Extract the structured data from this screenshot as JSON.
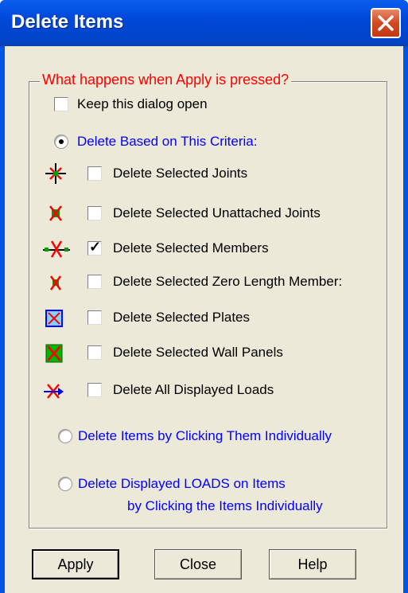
{
  "window": {
    "title": "Delete Items"
  },
  "group": {
    "legend": "What happens when Apply is pressed?"
  },
  "keep_open": {
    "label": "Keep this dialog open",
    "checked": false
  },
  "criteria_radio": {
    "label": "Delete Based on This Criteria:",
    "selected": true
  },
  "items": [
    {
      "label": "Delete Selected Joints",
      "checked": false,
      "icon": "joint-icon"
    },
    {
      "label": "Delete Selected Unattached Joints",
      "checked": false,
      "icon": "unattached-joint-icon"
    },
    {
      "label": "Delete Selected Members",
      "checked": true,
      "icon": "member-icon"
    },
    {
      "label": "Delete Selected Zero Length Member:",
      "checked": false,
      "icon": "zero-length-member-icon"
    },
    {
      "label": "Delete Selected Plates",
      "checked": false,
      "icon": "plate-icon"
    },
    {
      "label": "Delete Selected Wall Panels",
      "checked": false,
      "icon": "wall-panel-icon"
    },
    {
      "label": "Delete All Displayed Loads",
      "checked": false,
      "icon": "load-icon"
    }
  ],
  "individual_radio": {
    "label": "Delete Items by Clicking Them Individually",
    "selected": false
  },
  "loads_radio": {
    "line1": "Delete Displayed LOADS on Items",
    "line2": "by Clicking the Items Individually",
    "selected": false
  },
  "buttons": {
    "apply": "Apply",
    "close": "Close",
    "help": "Help"
  },
  "colors": {
    "title_bar": "#0054e3",
    "legend": "#ff0000",
    "radio_label": "#0000ff",
    "dialog_bg": "#ece9d8"
  }
}
